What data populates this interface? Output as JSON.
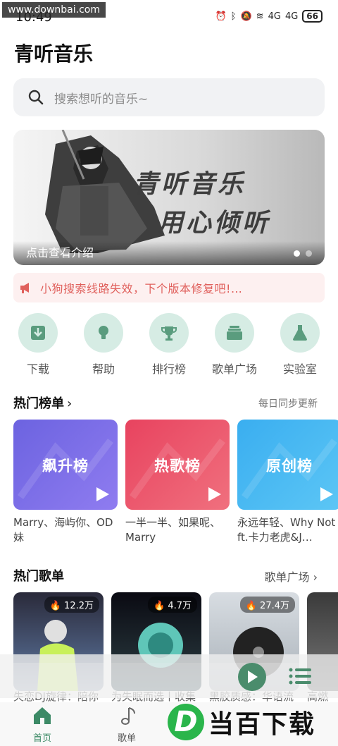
{
  "status_bar": {
    "time": "10:49",
    "watermark": "www.downbai.com",
    "signal_labels": [
      "4G",
      "4G"
    ],
    "battery": "66"
  },
  "app_title": "青听音乐",
  "search": {
    "placeholder": "搜索想听的音乐~",
    "icon": "search-icon"
  },
  "banner": {
    "line1": "青听音乐",
    "line2": "用心倾听",
    "caption": "点击查看介绍",
    "page_count": 2,
    "active_page": 1
  },
  "notice": {
    "icon": "megaphone-icon",
    "text": "小狗搜索线路失效，下个版本修复吧!…"
  },
  "quick_actions": [
    {
      "label": "下载",
      "icon": "download-icon"
    },
    {
      "label": "帮助",
      "icon": "lightbulb-icon"
    },
    {
      "label": "排行榜",
      "icon": "trophy-icon"
    },
    {
      "label": "歌单广场",
      "icon": "layers-icon"
    },
    {
      "label": "实验室",
      "icon": "flask-icon"
    }
  ],
  "hot_charts": {
    "title": "热门榜单",
    "right_text": "每日同步更新",
    "cards": [
      {
        "label": "飙升榜",
        "desc": "Marry、海屿你、OD妹",
        "color_a": "#6c63e0",
        "color_b": "#8f7cf0"
      },
      {
        "label": "热歌榜",
        "desc": "一半一半、如果呢、Marry",
        "color_a": "#e8435f",
        "color_b": "#f0707e"
      },
      {
        "label": "原创榜",
        "desc": "永远年轻、Why Not ft.卡力老虎&J…",
        "color_a": "#3aaef0",
        "color_b": "#5cc6f5"
      }
    ]
  },
  "hot_playlists": {
    "title": "热门歌单",
    "right_text": "歌单广场",
    "items": [
      {
        "count": "12.2万",
        "title": "失恋DJ旋律：陪你"
      },
      {
        "count": "4.7万",
        "title": "为失眠而选丨收集"
      },
      {
        "count": "27.4万",
        "title": "黑胶质感：华语流"
      },
      {
        "count": "",
        "title": "高燃"
      }
    ]
  },
  "mini_player": {
    "play_icon": "play-icon",
    "list_icon": "playlist-icon"
  },
  "tabs": [
    {
      "label": "首页",
      "icon": "home-icon",
      "active": true
    },
    {
      "label": "歌单",
      "icon": "music-note-icon",
      "active": false
    },
    {
      "label": "",
      "icon": "",
      "active": false
    },
    {
      "label": "",
      "icon": "",
      "active": false
    }
  ],
  "watermark_brand": {
    "logo_letter": "D",
    "text": "当百下载"
  },
  "colors": {
    "accent": "#4a8c6c",
    "notice_text": "#e0605c",
    "quick_bg": "#d6ece4",
    "tab_active": "#3c8a66"
  }
}
